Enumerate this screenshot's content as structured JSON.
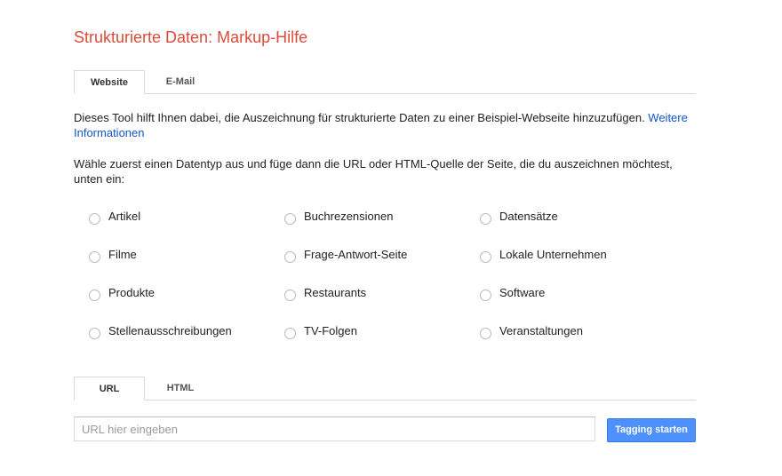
{
  "page": {
    "title": "Strukturierte Daten: Markup-Hilfe"
  },
  "source_tabs": [
    {
      "label": "Website",
      "active": true
    },
    {
      "label": "E-Mail",
      "active": false
    }
  ],
  "description": {
    "text": "Dieses Tool hilft Ihnen dabei, die Auszeichnung für strukturierte Daten zu einer Beispiel-Webseite hinzuzufügen. ",
    "link_label": "Weitere Informationen"
  },
  "instruction": "Wähle zuerst einen Datentyp aus und füge dann die URL oder HTML-Quelle der Seite, die du auszeichnen möchtest, unten ein:",
  "data_types": [
    "Artikel",
    "Buchrezensionen",
    "Datensätze",
    "Filme",
    "Frage-Antwort-Seite",
    "Lokale Unternehmen",
    "Produkte",
    "Restaurants",
    "Software",
    "Stellenausschreibungen",
    "TV-Folgen",
    "Veranstaltungen"
  ],
  "input_tabs": [
    {
      "label": "URL",
      "active": true
    },
    {
      "label": "HTML",
      "active": false
    }
  ],
  "url_input": {
    "value": "",
    "placeholder": "URL hier eingeben"
  },
  "start_button": {
    "label": "Tagging starten"
  },
  "colors": {
    "title": "#dd4b39",
    "link": "#1155cc",
    "button": "#4d90fe"
  }
}
